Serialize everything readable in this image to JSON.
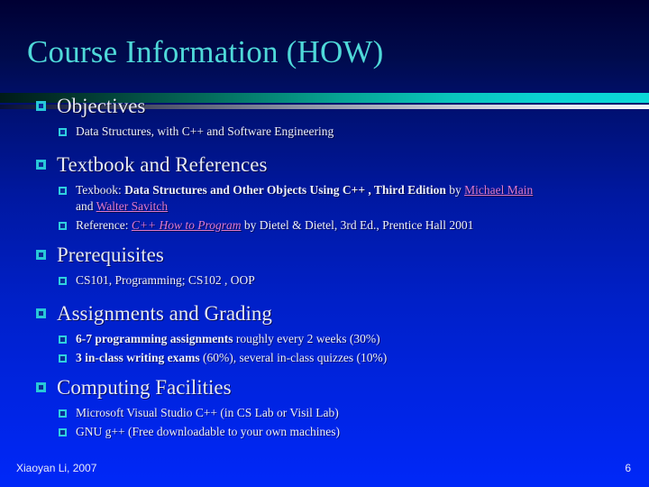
{
  "slide": {
    "title": "Course Information (HOW)",
    "page_number": "6",
    "footer_credit": "Xiaoyan Li, 2007",
    "colors": {
      "title": "#4fd9d9",
      "body_text": "#eef0fb",
      "bullet_marker": "#28c8d8",
      "hyperlink": "#e07ad0",
      "background_top": "#000033",
      "background_bottom": "#0028f8",
      "bar_accent": "#0bd8d8"
    }
  },
  "sections": [
    {
      "heading": "Objectives",
      "items": [
        {
          "text": "Data Structures, with C++ and Software Engineering"
        }
      ]
    },
    {
      "heading": "Textbook and References",
      "items": [
        {
          "prefix": "Texbook: ",
          "bold": "Data Structures and Other Objects Using C++ , Third Edition",
          "middle": " by ",
          "link1": "Michael Main",
          "continuation_prefix": "and ",
          "link2": "Walter Savitch"
        },
        {
          "prefix": "Reference: ",
          "link_italic": "C++ How to Program",
          "suffix": " by Dietel & Dietel, 3rd Ed., Prentice Hall 2001"
        }
      ]
    },
    {
      "heading": "Prerequisites",
      "items": [
        {
          "text": "CS101, Programming;  CS102 , OOP"
        }
      ]
    },
    {
      "heading": "Assignments and Grading",
      "items": [
        {
          "bold": "6-7 programming assignments",
          "rest": " roughly every 2 weeks (30%)"
        },
        {
          "bold": "3 in-class writing exams",
          "rest": " (60%), several in-class quizzes (10%)"
        }
      ]
    },
    {
      "heading": "Computing Facilities",
      "items": [
        {
          "text": "Microsoft Visual Studio C++  (in CS Lab or Visil Lab)"
        },
        {
          "text": "GNU g++ (Free downloadable to your own machines)"
        }
      ]
    }
  ]
}
